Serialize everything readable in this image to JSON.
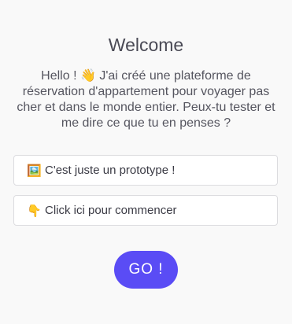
{
  "page": {
    "title": "Welcome",
    "intro": "Hello ! 👋 J'ai créé une plateforme de réservation d'appartement pour voyager pas cher et dans le monde entier. Peux-tu tester et me dire ce que tu en penses ?"
  },
  "options": [
    {
      "icon": "framed-picture-icon",
      "emoji": "🖼️",
      "label": "C'est juste un prototype !"
    },
    {
      "icon": "pointing-down-icon",
      "emoji": "👇",
      "label": "Click ici pour commencer"
    }
  ],
  "actions": {
    "go_label": "GO !"
  },
  "colors": {
    "background": "#f9f9f9",
    "accent": "#5a4cf5",
    "text": "#4a4a55",
    "card_border": "#dcdcdf"
  }
}
